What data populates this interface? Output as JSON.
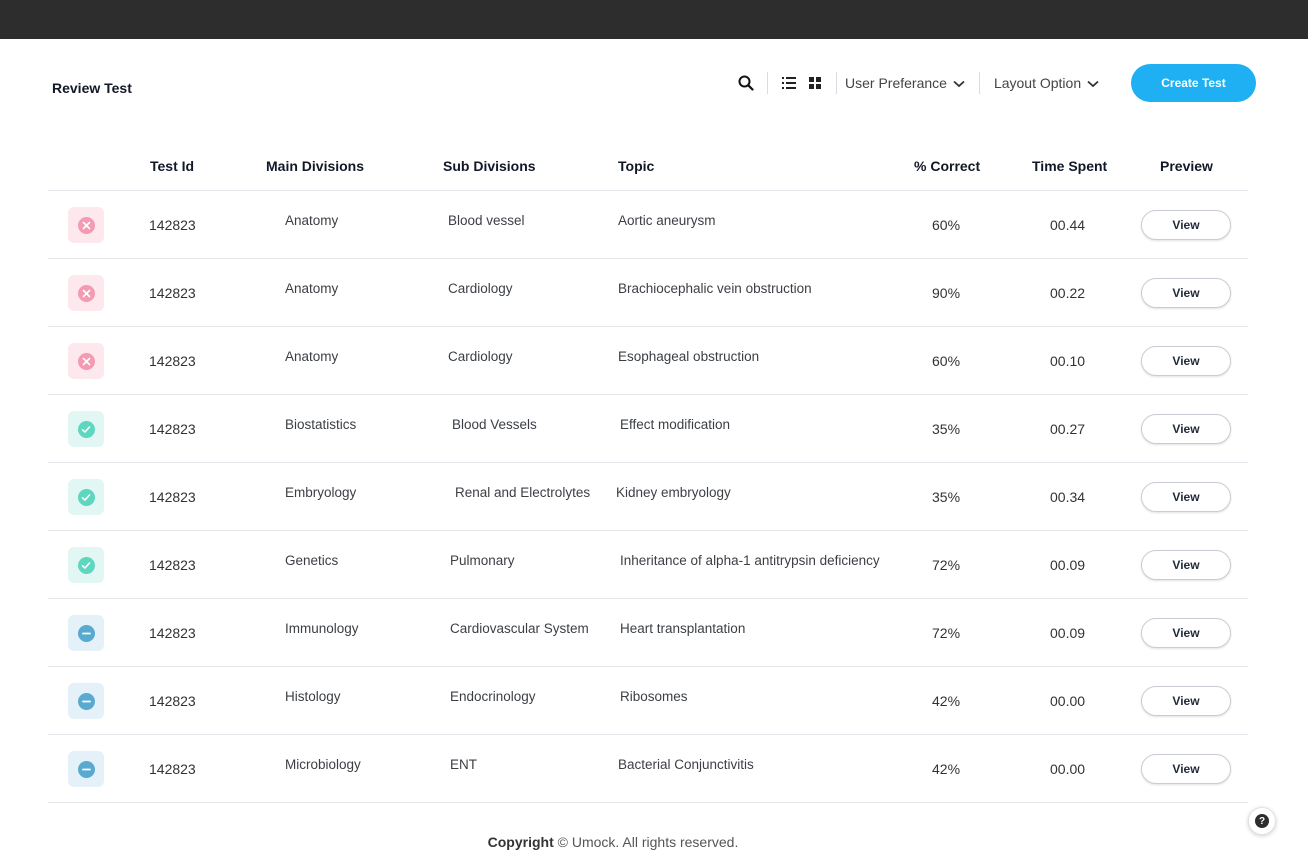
{
  "header": {
    "title": "Review Test",
    "user_pref_label": "User Preferance",
    "layout_label": "Layout Option",
    "create_label": "Create Test"
  },
  "icons": {
    "search": "search-icon",
    "list": "list-view-icon",
    "grid": "grid-view-icon",
    "chevron": "chevron-down-icon",
    "help": "help-icon"
  },
  "colors": {
    "accent": "#1eb0f2",
    "topbar": "#2d2d2d",
    "fail": "#f49ab5",
    "pass": "#5fd6bf",
    "omitted": "#5aa9cf"
  },
  "table": {
    "columns": [
      "Test Id",
      "Main Divisions",
      "Sub Divisions",
      "Topic",
      "% Correct",
      "Time Spent",
      "Preview"
    ],
    "rows": [
      {
        "status": "incorrect",
        "id": "142823",
        "main": "Anatomy",
        "sub": "Blood vessel",
        "topic": "Aortic aneurysm",
        "correct": "60%",
        "time": "00.44",
        "action": "View"
      },
      {
        "status": "incorrect",
        "id": "142823",
        "main": "Anatomy",
        "sub": "Cardiology",
        "topic": "Brachiocephalic vein obstruction",
        "correct": "90%",
        "time": "00.22",
        "action": "View"
      },
      {
        "status": "incorrect",
        "id": "142823",
        "main": "Anatomy",
        "sub": "Cardiology",
        "topic": "Esophageal obstruction",
        "correct": "60%",
        "time": "00.10",
        "action": "View"
      },
      {
        "status": "correct",
        "id": "142823",
        "main": "Biostatistics",
        "sub": "Blood Vessels",
        "topic": "Effect modification",
        "correct": "35%",
        "time": "00.27",
        "action": "View"
      },
      {
        "status": "correct",
        "id": "142823",
        "main": "Embryology",
        "sub": "Renal and Electrolytes",
        "topic": "Kidney embryology",
        "correct": "35%",
        "time": "00.34",
        "action": "View"
      },
      {
        "status": "correct",
        "id": "142823",
        "main": "Genetics",
        "sub": "Pulmonary",
        "topic": "Inheritance of alpha-1 antitrypsin deficiency",
        "correct": "72%",
        "time": "00.09",
        "action": "View"
      },
      {
        "status": "omitted",
        "id": "142823",
        "main": "Immunology",
        "sub": "Cardiovascular System",
        "topic": "Heart transplantation",
        "correct": "72%",
        "time": "00.09",
        "action": "View"
      },
      {
        "status": "omitted",
        "id": "142823",
        "main": "Histology",
        "sub": "Endocrinology",
        "topic": "Ribosomes",
        "correct": "42%",
        "time": "00.00",
        "action": "View"
      },
      {
        "status": "omitted",
        "id": "142823",
        "main": "Microbiology",
        "sub": "ENT",
        "topic": "Bacterial Conjunctivitis",
        "correct": "42%",
        "time": "00.00",
        "action": "View"
      }
    ]
  },
  "footer": {
    "bold": "Copyright",
    "text": "© Umock. All rights reserved."
  }
}
